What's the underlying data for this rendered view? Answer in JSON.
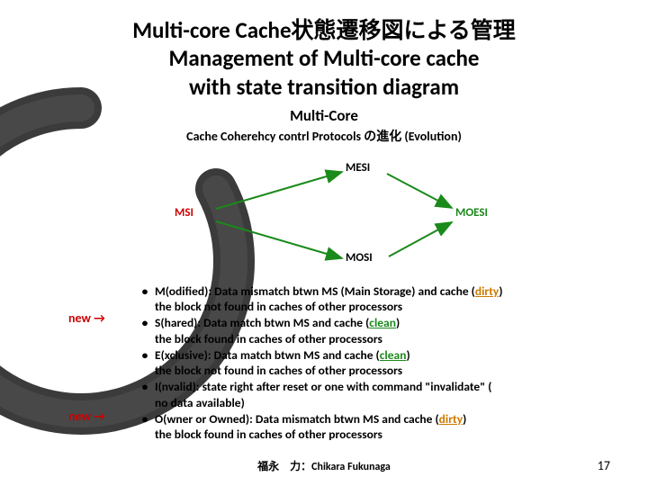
{
  "title_line1": "Multi-core Cache状態遷移図による管理",
  "title_line2": "Management of Multi-core cache",
  "title_line3": "with state transition diagram",
  "sub1": "Multi-Core",
  "sub2": "Cache Coherehcy contrl Protocols の進化 (Evolution)",
  "nodes": {
    "msi": "MSI",
    "mesi": "MESI",
    "mosi": "MOSI",
    "moesi": "MOESI"
  },
  "new_label": "new →",
  "bullets": [
    {
      "head": "M(odified): Data mismatch btwn MS (Main Storage) and cache (",
      "state": "dirty",
      "tail": ")",
      "sub": "the block not found in caches of other processors"
    },
    {
      "head": "S(hared): Data match btwn MS and cache (",
      "state": "clean",
      "tail": ")",
      "sub": "the block found in caches of other processors"
    },
    {
      "head": "E(xclusive): Data match btwn MS and cache (",
      "state": "clean",
      "tail": ")",
      "sub": "the block not found in caches of other processors"
    },
    {
      "head": "I(nvalid): state right after reset or one with command \"invalidate\" (",
      "state": "",
      "tail": "",
      "sub": "no data available)"
    },
    {
      "head": "O(wner or Owned): Data mismatch btwn MS and cache (",
      "state": "dirty",
      "tail": ")",
      "sub": "the block found in caches of other processors"
    }
  ],
  "dirty_word": "dirty",
  "clean_word": "clean",
  "author": "福永　力：Chikara Fukunaga",
  "page": "17"
}
